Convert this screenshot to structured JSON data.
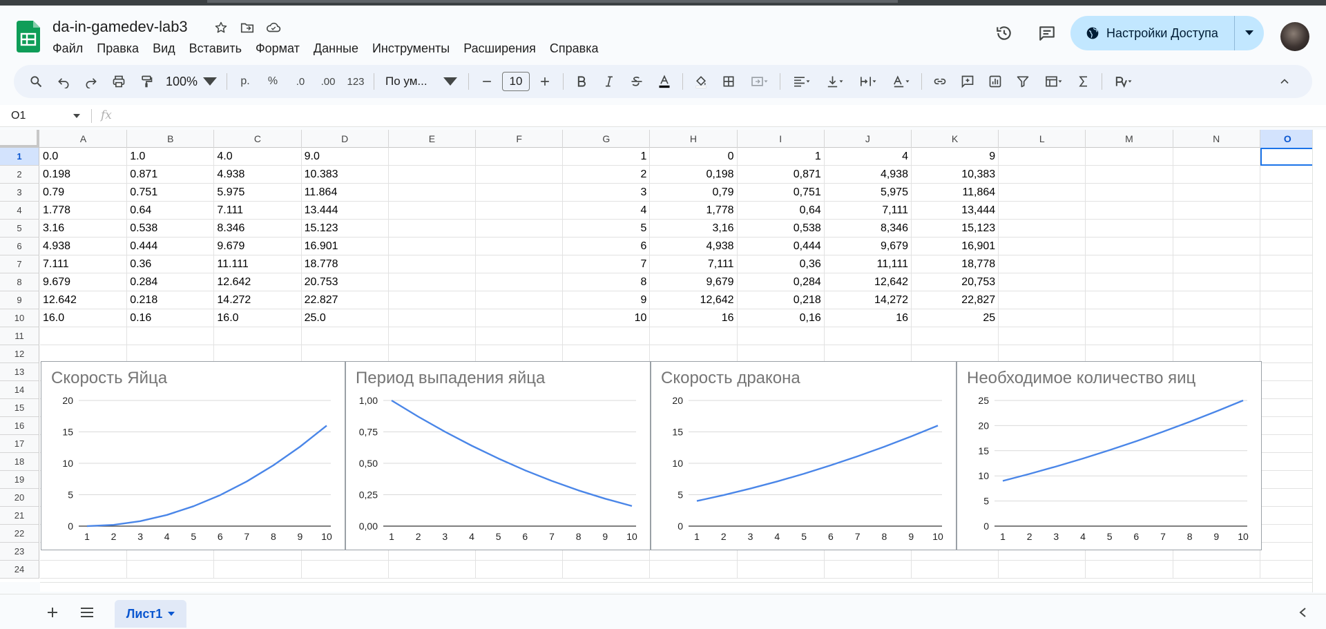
{
  "doc": {
    "title": "da-in-gamedev-lab3",
    "menu": [
      "Файл",
      "Правка",
      "Вид",
      "Вставить",
      "Формат",
      "Данные",
      "Инструменты",
      "Расширения",
      "Справка"
    ],
    "share_label": "Настройки Доступа"
  },
  "toolbar": {
    "zoom": "100%",
    "currency": "р.",
    "percent": "%",
    "dec_minus": ".0",
    "dec_plus": ".00",
    "number_format": "123",
    "font_name": "По ум...",
    "font_size": "10"
  },
  "formula_bar": {
    "cell_ref": "O1",
    "fx": "fx"
  },
  "sheet": {
    "columns": [
      "A",
      "B",
      "C",
      "D",
      "E",
      "F",
      "G",
      "H",
      "I",
      "J",
      "K",
      "L",
      "M",
      "N",
      "O"
    ],
    "rows": [
      "1",
      "2",
      "3",
      "4",
      "5",
      "6",
      "7",
      "8",
      "9",
      "10",
      "11",
      "12",
      "13",
      "14",
      "15",
      "16",
      "17",
      "18",
      "19",
      "20",
      "21",
      "22",
      "23",
      "24"
    ],
    "selected_column": "O",
    "selected_row": "1",
    "left_table": [
      [
        "0.0",
        "1.0",
        "4.0",
        "9.0"
      ],
      [
        "0.198",
        "0.871",
        "4.938",
        "10.383"
      ],
      [
        "0.79",
        "0.751",
        "5.975",
        "11.864"
      ],
      [
        "1.778",
        "0.64",
        "7.111",
        "13.444"
      ],
      [
        "3.16",
        "0.538",
        "8.346",
        "15.123"
      ],
      [
        "4.938",
        "0.444",
        "9.679",
        "16.901"
      ],
      [
        "7.111",
        "0.36",
        "11.111",
        "18.778"
      ],
      [
        "9.679",
        "0.284",
        "12.642",
        "20.753"
      ],
      [
        "12.642",
        "0.218",
        "14.272",
        "22.827"
      ],
      [
        "16.0",
        "0.16",
        "16.0",
        "25.0"
      ]
    ],
    "right_table": [
      [
        "1",
        "0",
        "1",
        "4",
        "9"
      ],
      [
        "2",
        "0,198",
        "0,871",
        "4,938",
        "10,383"
      ],
      [
        "3",
        "0,79",
        "0,751",
        "5,975",
        "11,864"
      ],
      [
        "4",
        "1,778",
        "0,64",
        "7,111",
        "13,444"
      ],
      [
        "5",
        "3,16",
        "0,538",
        "8,346",
        "15,123"
      ],
      [
        "6",
        "4,938",
        "0,444",
        "9,679",
        "16,901"
      ],
      [
        "7",
        "7,111",
        "0,36",
        "11,111",
        "18,778"
      ],
      [
        "8",
        "9,679",
        "0,284",
        "12,642",
        "20,753"
      ],
      [
        "9",
        "12,642",
        "0,218",
        "14,272",
        "22,827"
      ],
      [
        "10",
        "16",
        "0,16",
        "16",
        "25"
      ]
    ],
    "tab_name": "Лист1"
  },
  "colors": {
    "line": "#4a86e8",
    "accent": "#0b57d0",
    "share_bg": "#c2e7ff"
  },
  "chart_data": [
    {
      "type": "line",
      "title": "Скорость Яйца",
      "x": [
        1,
        2,
        3,
        4,
        5,
        6,
        7,
        8,
        9,
        10
      ],
      "values": [
        0,
        0.198,
        0.79,
        1.778,
        3.16,
        4.938,
        7.111,
        9.679,
        12.642,
        16
      ],
      "yticks": [
        "0",
        "5",
        "10",
        "15",
        "20"
      ],
      "ylim": [
        0,
        20
      ]
    },
    {
      "type": "line",
      "title": "Период выпадения яйца",
      "x": [
        1,
        2,
        3,
        4,
        5,
        6,
        7,
        8,
        9,
        10
      ],
      "values": [
        1,
        0.871,
        0.751,
        0.64,
        0.538,
        0.444,
        0.36,
        0.284,
        0.218,
        0.16
      ],
      "yticks": [
        "0,00",
        "0,25",
        "0,50",
        "0,75",
        "1,00"
      ],
      "ylim": [
        0,
        1
      ]
    },
    {
      "type": "line",
      "title": "Скорость дракона",
      "x": [
        1,
        2,
        3,
        4,
        5,
        6,
        7,
        8,
        9,
        10
      ],
      "values": [
        4,
        4.938,
        5.975,
        7.111,
        8.346,
        9.679,
        11.111,
        12.642,
        14.272,
        16
      ],
      "yticks": [
        "0",
        "5",
        "10",
        "15",
        "20"
      ],
      "ylim": [
        0,
        20
      ]
    },
    {
      "type": "line",
      "title": "Необходимое количество яиц",
      "x": [
        1,
        2,
        3,
        4,
        5,
        6,
        7,
        8,
        9,
        10
      ],
      "values": [
        9,
        10.383,
        11.864,
        13.444,
        15.123,
        16.901,
        18.778,
        20.753,
        22.827,
        25
      ],
      "yticks": [
        "0",
        "5",
        "10",
        "15",
        "20",
        "25"
      ],
      "ylim": [
        0,
        25
      ]
    }
  ]
}
